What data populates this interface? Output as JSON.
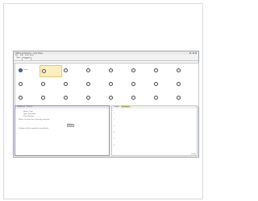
{
  "window": {
    "title": "Office Scheduler - Grid View"
  },
  "menu": [
    "File",
    "Edit",
    "View",
    "Help"
  ],
  "tabs": [
    {
      "label": "Main"
    },
    {
      "label": "Layout"
    }
  ],
  "grid": {
    "rows": [
      [
        "Name",
        "",
        "",
        "",
        "",
        "",
        "",
        ""
      ],
      [
        "",
        "",
        "",
        "",
        "",
        "",
        "",
        ""
      ],
      [
        "",
        "",
        "",
        "",
        "",
        "",
        "",
        ""
      ]
    ],
    "selected_cell": "r0c1"
  },
  "left_panel": {
    "tabs": [
      "Properties",
      "Events"
    ],
    "lines": [
      "Name: Item",
      "Type: Standard",
      "Size: Medium",
      "Notes: no items are currently selected"
    ],
    "button": "Apply",
    "footer": "Changes will be applied immediately"
  },
  "right_panel": {
    "tabs": [
      "Output",
      "Messages"
    ],
    "line_numbers": [
      "1",
      "2",
      "3",
      "4",
      "5",
      "6"
    ],
    "status": "Ready"
  },
  "colors": {
    "accent": "#4a6fa8",
    "selection": "#fbeec0",
    "panel_border": "#8f8fb8"
  }
}
